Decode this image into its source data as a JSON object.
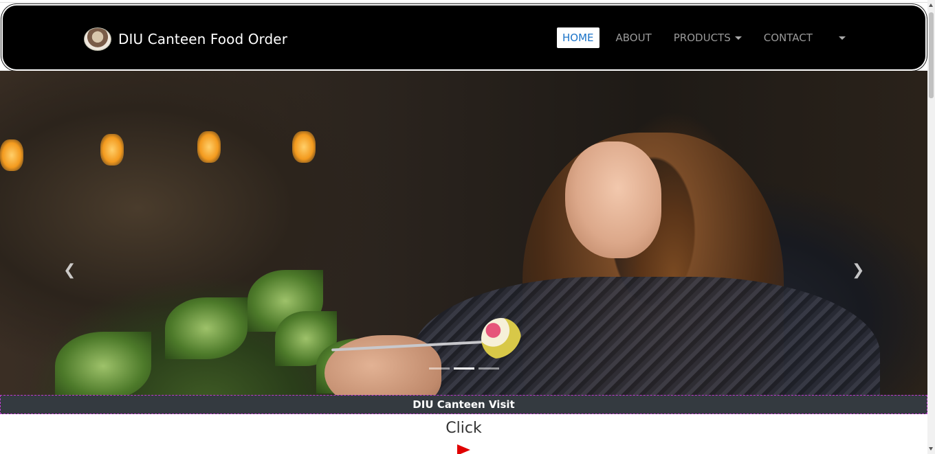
{
  "brand": {
    "name": "DIU Canteen Food Order",
    "logo_icon": "canteen-logo-icon"
  },
  "nav": {
    "items": [
      {
        "label": "HOME",
        "active": true
      },
      {
        "label": "ABOUT",
        "active": false
      },
      {
        "label": "PRODUCTS",
        "active": false,
        "dropdown": true
      },
      {
        "label": "CONTACT",
        "active": false
      }
    ],
    "extra_dropdown_icon": "caret-down-icon"
  },
  "carousel": {
    "prev_icon": "chevron-left-icon",
    "next_icon": "chevron-right-icon",
    "prev_glyph": "❮",
    "next_glyph": "❯",
    "active_slide": 2,
    "slide_count": 3
  },
  "caption": {
    "text": "DIU Canteen Visit"
  },
  "cta": {
    "text": "Click",
    "icon": "play-icon"
  },
  "colors": {
    "navbar_bg": "#000000",
    "active_nav_text": "#1a73c8",
    "caption_bg": "#343a40",
    "play_red": "#e00000"
  }
}
